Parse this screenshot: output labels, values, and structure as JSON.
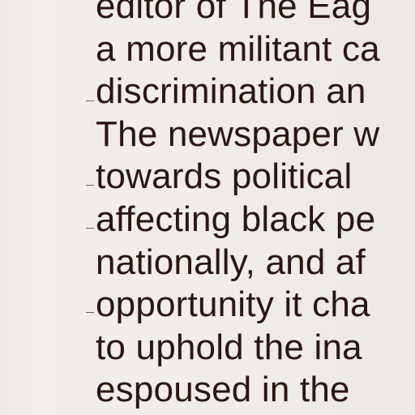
{
  "document": {
    "lines": [
      "editor of The Eag",
      "a more militant ca",
      "discrimination an",
      "The newspaper w",
      "towards political",
      "affecting black pe",
      "nationally, and af",
      "opportunity it cha",
      "to uphold the ina",
      "espoused in the"
    ]
  }
}
